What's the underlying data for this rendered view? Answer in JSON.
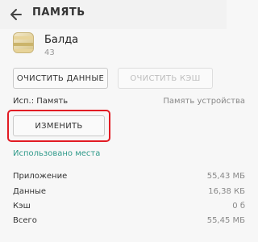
{
  "header": {
    "title": "ПАМЯТЬ"
  },
  "app": {
    "name": "Балда",
    "version": "43"
  },
  "buttons": {
    "clear_data": "ОЧИСТИТЬ ДАННЫЕ",
    "clear_cache": "ОЧИСТИТЬ КЭШ",
    "change": "ИЗМЕНИТЬ"
  },
  "storage": {
    "label": "Исп.: Память",
    "value": "Память устройства"
  },
  "section_title": "Использовано места",
  "usage": [
    {
      "label": "Приложение",
      "value": "55,43 МБ"
    },
    {
      "label": "Данные",
      "value": "16,38 КБ"
    },
    {
      "label": "Кэш",
      "value": "0 б"
    },
    {
      "label": "Всего",
      "value": "55,45 МБ"
    }
  ],
  "colors": {
    "accent": "#2f9a8a",
    "highlight": "#e21b23"
  }
}
